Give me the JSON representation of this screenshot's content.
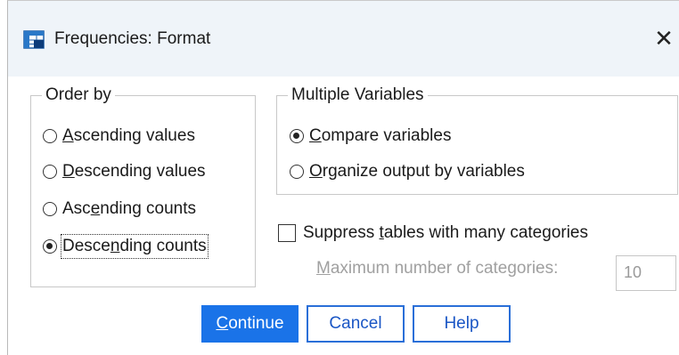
{
  "window": {
    "title": "Frequencies: Format",
    "close_icon": "close-icon",
    "app_icon": "spss-table-icon"
  },
  "order_by": {
    "legend": "Order by",
    "options": [
      {
        "pre": "",
        "u": "A",
        "post": "scending values",
        "checked": false
      },
      {
        "pre": "",
        "u": "D",
        "post": "escending values",
        "checked": false
      },
      {
        "pre": "Asc",
        "u": "e",
        "post": "nding counts",
        "checked": false
      },
      {
        "pre": "Desce",
        "u": "n",
        "post": "ding counts",
        "checked": true
      }
    ]
  },
  "multiple_variables": {
    "legend": "Multiple Variables",
    "options": [
      {
        "pre": "",
        "u": "C",
        "post": "ompare variables",
        "checked": true
      },
      {
        "pre": "",
        "u": "O",
        "post": "rganize output by variables",
        "checked": false
      }
    ]
  },
  "suppress": {
    "pre": "Suppress ",
    "u": "t",
    "post": "ables with many categories",
    "checked": false,
    "max_label_u": "M",
    "max_label_post": "aximum number of categories:",
    "max_value": "10"
  },
  "buttons": {
    "continue_u": "C",
    "continue_post": "ontinue",
    "cancel": "Cancel",
    "help": "Help"
  },
  "colors": {
    "titlebar": "#eff4f9",
    "primary": "#1a73e8",
    "button_border": "#2a6fd8"
  }
}
